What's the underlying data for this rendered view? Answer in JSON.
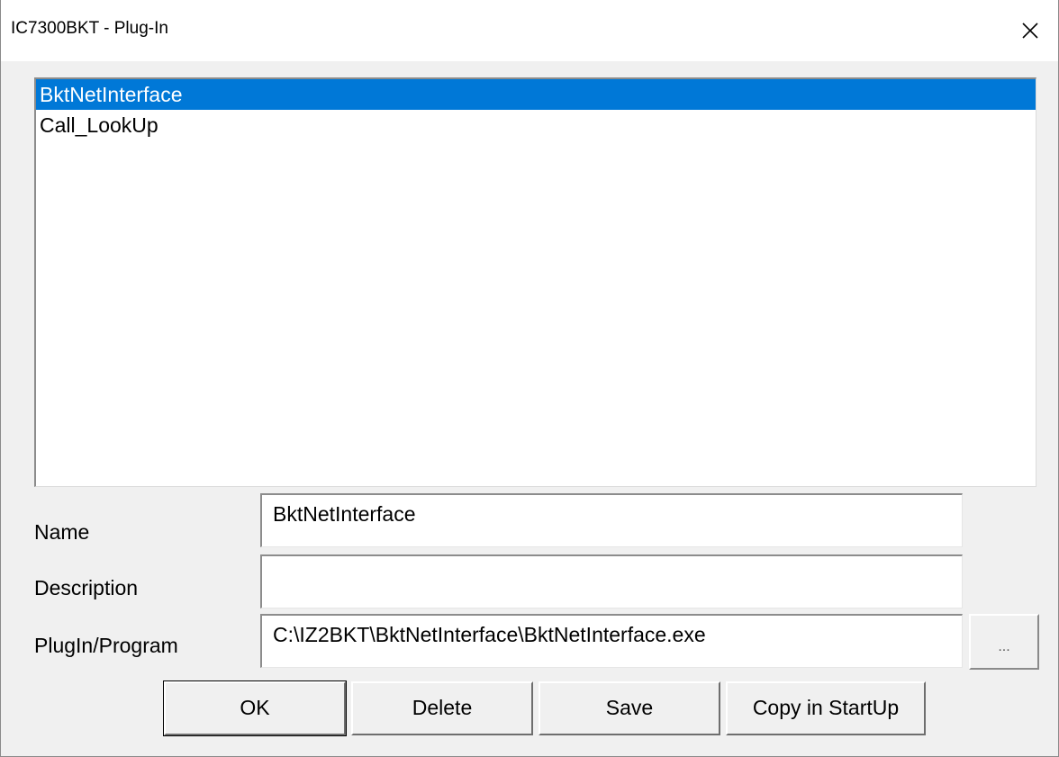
{
  "window": {
    "title": "IC7300BKT - Plug-In"
  },
  "plugin_list": {
    "items": [
      {
        "label": "BktNetInterface",
        "selected": true
      },
      {
        "label": "Call_LookUp",
        "selected": false
      }
    ]
  },
  "form": {
    "name_label": "Name",
    "name_value": "BktNetInterface",
    "description_label": "Description",
    "description_value": "",
    "program_label": "PlugIn/Program",
    "program_value": "C:\\IZ2BKT\\BktNetInterface\\BktNetInterface.exe",
    "browse_label": "..."
  },
  "buttons": {
    "ok": "OK",
    "delete": "Delete",
    "save": "Save",
    "copy_startup": "Copy in StartUp"
  },
  "colors": {
    "selection": "#0078d7",
    "background": "#f0f0f0"
  },
  "icons": {
    "close": "close-icon"
  }
}
